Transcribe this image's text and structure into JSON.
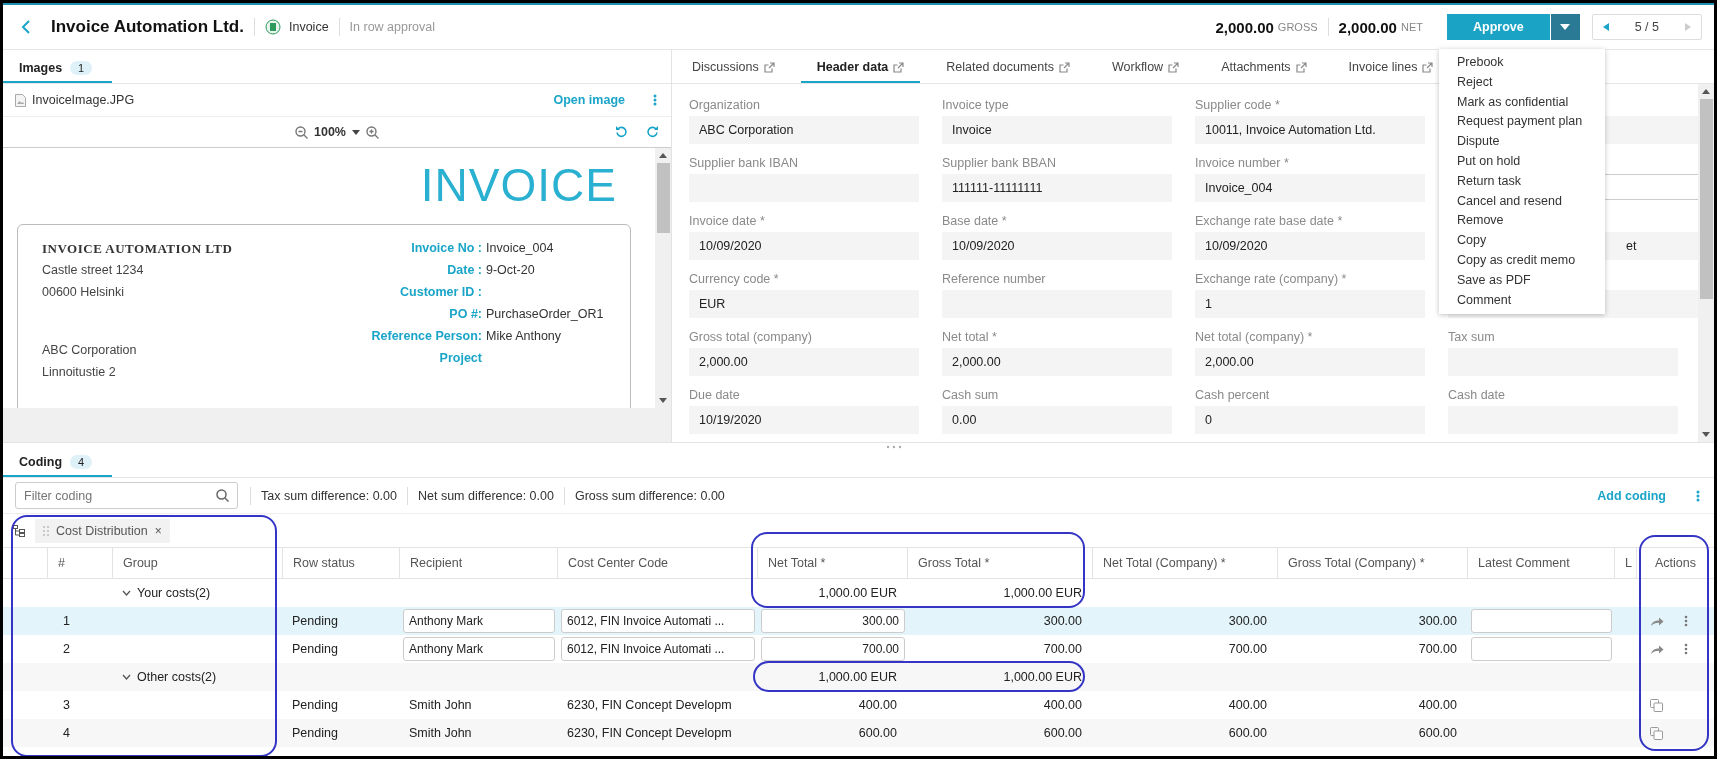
{
  "header": {
    "title": "Invoice Automation Ltd.",
    "doc_type": "Invoice",
    "status": "In row approval",
    "gross_amount": "2,000.00",
    "gross_label": "GROSS",
    "net_amount": "2,000.00",
    "net_label": "NET",
    "approve_label": "Approve",
    "pager": "5 / 5"
  },
  "actions_menu": {
    "items": [
      "Prebook",
      "Reject",
      "Mark as confidential",
      "Request payment plan",
      "Dispute",
      "Put on hold",
      "Return task",
      "Cancel and resend",
      "Remove",
      "Copy",
      "Copy as credit memo",
      "Save as PDF",
      "Comment"
    ]
  },
  "images_panel": {
    "tab": {
      "label": "Images",
      "count": "1",
      "selected": true
    },
    "file_name": "InvoiceImage.JPG",
    "open_link": "Open image",
    "zoom": "100%"
  },
  "invoice_document": {
    "heading": "INVOICE",
    "company": "INVOICE AUTOMATION LTD",
    "address": [
      "Castle street 1234",
      "00600 Helsinki"
    ],
    "customer": [
      "ABC Corporation",
      "Linnoitustie 2"
    ],
    "fields": [
      {
        "label": "Invoice No :",
        "value": "Invoice_004"
      },
      {
        "label": "Date :",
        "value": "9-Oct-20"
      },
      {
        "label": "Customer ID :"
      },
      {
        "label": "PO #:",
        "value": "PurchaseOrder_OR1"
      },
      {
        "label": "Reference Person:",
        "value": "Mike Anthony"
      },
      {
        "label": "Project"
      }
    ]
  },
  "detail_tabs": [
    {
      "label": "Discussions",
      "selected": false
    },
    {
      "label": "Header data",
      "selected": true
    },
    {
      "label": "Related documents",
      "selected": false
    },
    {
      "label": "Workflow",
      "selected": false
    },
    {
      "label": "Attachments",
      "selected": false
    },
    {
      "label": "Invoice lines",
      "selected": false
    }
  ],
  "header_fields": [
    {
      "kind": "readonly",
      "label": "Organization",
      "value": "ABC Corporation"
    },
    {
      "kind": "readonly",
      "label": "Invoice type",
      "value": "Invoice"
    },
    {
      "kind": "readonly",
      "label": "Supplier code *",
      "value": "10011, Invoice Automation Ltd."
    },
    {
      "kind": "readonly",
      "covered": true
    },
    {
      "kind": "readonly",
      "label": "Supplier bank IBAN"
    },
    {
      "kind": "readonly",
      "label": "Supplier bank BBAN",
      "value": "111111-11111111"
    },
    {
      "kind": "readonly",
      "label": "Invoice number *",
      "value": "Invoice_004"
    },
    {
      "kind": "input",
      "covered": true
    },
    {
      "kind": "readonly",
      "label": "Invoice date *",
      "value": "10/09/2020"
    },
    {
      "kind": "readonly",
      "label": "Base date *",
      "value": "10/09/2020"
    },
    {
      "kind": "readonly",
      "label": "Exchange rate base date *",
      "value": "10/09/2020"
    },
    {
      "kind": "readonly",
      "covered": true,
      "value": "et"
    },
    {
      "kind": "readonly",
      "label": "Currency code *",
      "value": "EUR"
    },
    {
      "kind": "readonly",
      "label": "Reference number"
    },
    {
      "kind": "readonly",
      "label": "Exchange rate (company) *",
      "value": "1"
    },
    {
      "kind": "readonly",
      "covered": true
    },
    {
      "kind": "readonly",
      "label": "Gross total (company)",
      "value": "2,000.00"
    },
    {
      "kind": "readonly",
      "label": "Net total *",
      "value": "2,000.00"
    },
    {
      "kind": "readonly",
      "label": "Net total (company) *",
      "value": "2,000.00"
    },
    {
      "kind": "readonly",
      "label": "Tax sum"
    },
    {
      "kind": "readonly",
      "label": "Due date",
      "value": "10/19/2020"
    },
    {
      "kind": "readonly",
      "label": "Cash sum",
      "value": "0.00"
    },
    {
      "kind": "readonly",
      "label": "Cash percent",
      "value": "0"
    },
    {
      "kind": "readonly",
      "label": "Cash date"
    }
  ],
  "coding": {
    "tab": {
      "label": "Coding",
      "count": "4",
      "selected": true
    },
    "filter_placeholder": "Filter coding",
    "summaries": [
      "Tax sum difference: 0.00",
      "Net sum difference: 0.00",
      "Gross sum difference: 0.00"
    ],
    "add_link": "Add coding",
    "group_chip": {
      "label": "Cost Distribution",
      "close": "×"
    },
    "columns": [
      "#",
      "Group",
      "Row status",
      "Recipient",
      "Cost Center Code",
      "Net Total *",
      "Gross Total *",
      "Net Total (Company) *",
      "Gross Total (Company) *",
      "Latest Comment",
      "L",
      "Actions"
    ],
    "rows": [
      {
        "kind": "group",
        "label": "Your costs",
        "count": "(2)",
        "expanded": true,
        "net_total": "1,000.00 EUR",
        "gross_total": "1,000.00 EUR"
      },
      {
        "kind": "line",
        "number": "1",
        "status": "Pending",
        "recipient": "Anthony Mark",
        "cost_center": "6012, FIN Invoice Automati ...",
        "net_total": "300.00",
        "gross_total": "300.00",
        "net_company": "300.00",
        "gross_company": "300.00",
        "editable": true,
        "selected": true
      },
      {
        "kind": "line",
        "number": "2",
        "status": "Pending",
        "recipient": "Anthony Mark",
        "cost_center": "6012, FIN Invoice Automati ...",
        "net_total": "700.00",
        "gross_total": "700.00",
        "net_company": "700.00",
        "gross_company": "700.00",
        "editable": true,
        "selected": false
      },
      {
        "kind": "group",
        "label": "Other costs",
        "count": "(2)",
        "expanded": true,
        "net_total": "1,000.00 EUR",
        "gross_total": "1,000.00 EUR"
      },
      {
        "kind": "line",
        "number": "3",
        "status": "Pending",
        "recipient": "Smith John",
        "cost_center": "6230, FIN Concept Developm",
        "net_total": "400.00",
        "gross_total": "400.00",
        "net_company": "400.00",
        "gross_company": "400.00",
        "editable": false,
        "selected": false
      },
      {
        "kind": "line",
        "number": "4",
        "status": "Pending",
        "recipient": "Smith John",
        "cost_center": "6230, FIN Concept Developm",
        "net_total": "600.00",
        "gross_total": "600.00",
        "net_company": "600.00",
        "gross_company": "600.00",
        "editable": false,
        "selected": false
      }
    ]
  }
}
